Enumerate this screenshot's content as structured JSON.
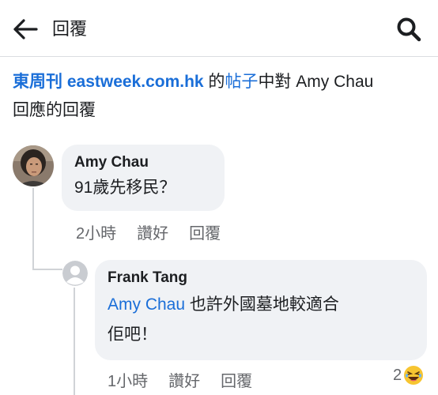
{
  "header": {
    "title": "回覆",
    "back_icon": "arrow-left-icon",
    "search_icon": "search-icon"
  },
  "context": {
    "page_name": "東周刊 eastweek.com.hk",
    "text_de": " 的",
    "post_link": "帖子",
    "text_middle": "中對 Amy Chau",
    "text_end": "回應的回覆"
  },
  "comments": [
    {
      "author": "Amy Chau",
      "text": "91歲先移民？",
      "time": "2小時",
      "like_label": "讚好",
      "reply_label": "回覆"
    },
    {
      "author": "Frank Tang",
      "mention": "Amy Chau",
      "text_line1": " 也許外國墓地較適合",
      "text_line2": "佢吧！",
      "time": "1小時",
      "like_label": "讚好",
      "reply_label": "回覆",
      "reaction_count": "2",
      "reaction_icon": "laughing-emoji-icon"
    }
  ],
  "colors": {
    "link": "#1a6ed8",
    "bubble": "#f0f2f5",
    "secondary_text": "#65676b"
  }
}
